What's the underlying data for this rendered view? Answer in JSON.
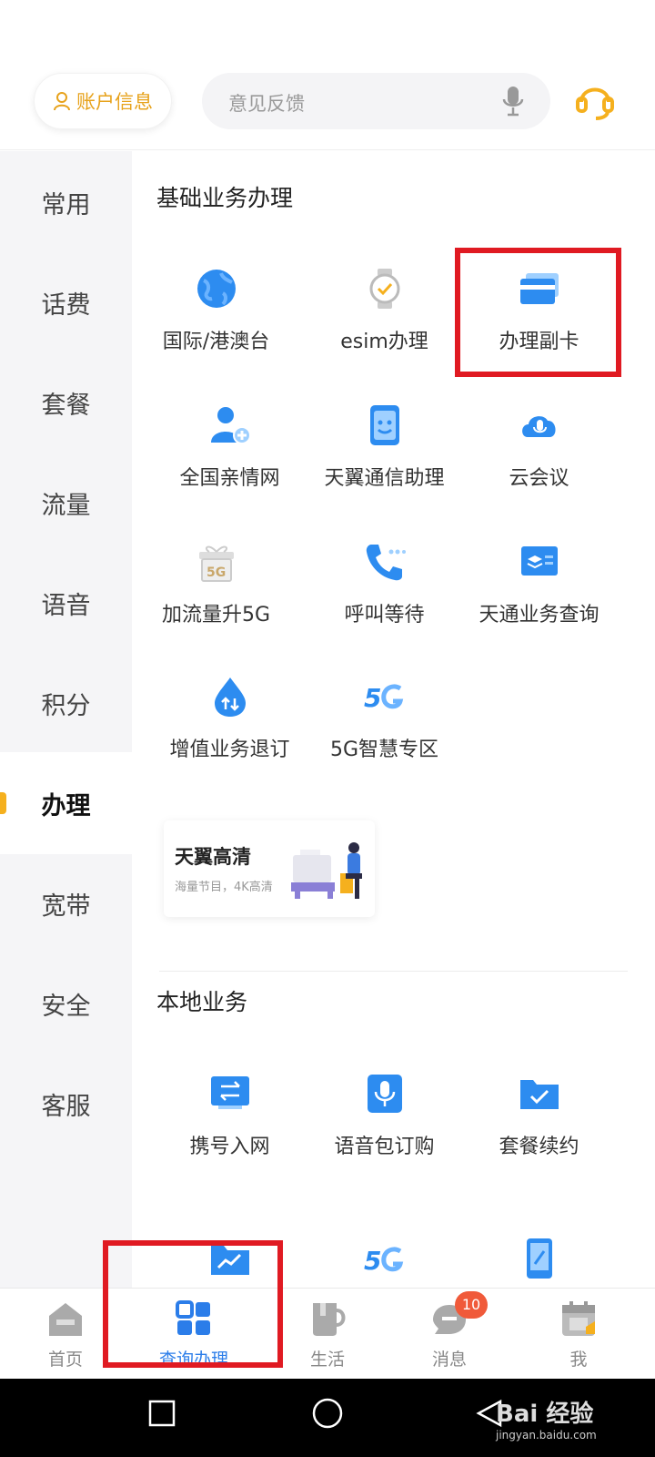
{
  "header": {
    "account_label": "账户信息",
    "search_placeholder": "意见反馈"
  },
  "sidebar": {
    "items": [
      {
        "label": "常用",
        "active": false
      },
      {
        "label": "话费",
        "active": false
      },
      {
        "label": "套餐",
        "active": false
      },
      {
        "label": "流量",
        "active": false
      },
      {
        "label": "语音",
        "active": false
      },
      {
        "label": "积分",
        "active": false
      },
      {
        "label": "办理",
        "active": true
      },
      {
        "label": "宽带",
        "active": false
      },
      {
        "label": "安全",
        "active": false
      },
      {
        "label": "客服",
        "active": false
      }
    ]
  },
  "sections": {
    "basic": {
      "title": "基础业务办理",
      "items": [
        {
          "label": "国际/港澳台",
          "icon": "globe-icon"
        },
        {
          "label": "esim办理",
          "icon": "watch-icon"
        },
        {
          "label": "办理副卡",
          "icon": "card-icon"
        },
        {
          "label": "全国亲情网",
          "icon": "user-add-icon"
        },
        {
          "label": "天翼通信助理",
          "icon": "phone-assistant-icon"
        },
        {
          "label": "云会议",
          "icon": "cloud-mic-icon"
        },
        {
          "label": "加流量升5G",
          "icon": "gift-5g-icon"
        },
        {
          "label": "呼叫等待",
          "icon": "phone-wait-icon"
        },
        {
          "label": "天通业务查询",
          "icon": "satellite-doc-icon"
        },
        {
          "label": "增值业务退订",
          "icon": "drop-arrows-icon"
        },
        {
          "label": "5G智慧专区",
          "icon": "5g-icon"
        }
      ]
    },
    "banner": {
      "title": "天翼高清",
      "subtitle": "海量节目，4K高清"
    },
    "local": {
      "title": "本地业务",
      "items": [
        {
          "label": "携号入网",
          "icon": "transfer-icon"
        },
        {
          "label": "语音包订购",
          "icon": "mic-icon"
        },
        {
          "label": "套餐续约",
          "icon": "folder-check-icon"
        }
      ]
    }
  },
  "tabbar": {
    "items": [
      {
        "label": "首页",
        "icon": "home-icon"
      },
      {
        "label": "查询办理",
        "icon": "grid-icon",
        "active": true
      },
      {
        "label": "生活",
        "icon": "cup-icon"
      },
      {
        "label": "消息",
        "icon": "chat-icon"
      },
      {
        "label": "我",
        "icon": "calendar-sign-icon"
      }
    ],
    "message_badge": "10"
  },
  "watermark": {
    "brand": "Bai 经验",
    "url": "jingyan.baidu.com"
  },
  "colors": {
    "accent_blue": "#2b7de9",
    "brand_gold": "#e7a21b",
    "highlight_red": "#e01a22",
    "badge_red": "#f05a3a"
  }
}
